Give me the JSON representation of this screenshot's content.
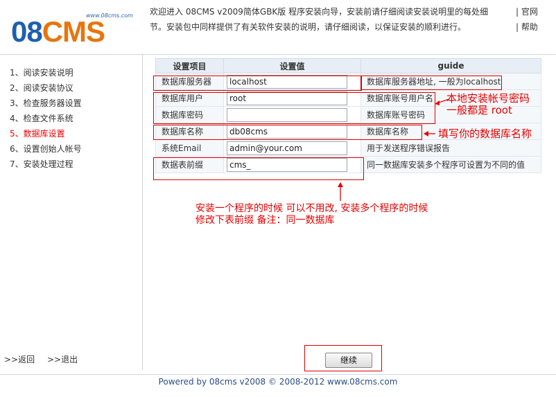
{
  "header": {
    "logo": {
      "tagline": "www.08cms.com",
      "mark_left": "08",
      "mark_right": "CMS"
    },
    "intro_line1": "欢迎进入 08CMS v2009简体GBK版 程序安装向导，安装前请仔细阅读安装说明里的每处细",
    "intro_line2": "节。安装包中同样提供了有关软件安装的说明，请仔细阅读，以保证安装的顺利进行。",
    "links": [
      "| 官网",
      "| 帮助"
    ]
  },
  "sidebar": {
    "steps": [
      {
        "label": "1、阅读安装说明",
        "active": false
      },
      {
        "label": "2、阅读安装协议",
        "active": false
      },
      {
        "label": "3、检查服务器设置",
        "active": false
      },
      {
        "label": "4、检查文件系统",
        "active": false
      },
      {
        "label": "5、数据库设置",
        "active": true
      },
      {
        "label": "6、设置创始人帐号",
        "active": false
      },
      {
        "label": "7、安装处理过程",
        "active": false
      }
    ],
    "back": ">>返回",
    "exit": ">>退出"
  },
  "table": {
    "headers": [
      "设置项目",
      "设置值",
      "guide"
    ],
    "rows": [
      {
        "name": "数据库服务器",
        "value": "localhost",
        "guide": "数据库服务器地址, 一般为localhost"
      },
      {
        "name": "数据库用户",
        "value": "root",
        "guide": "数据库账号用户名"
      },
      {
        "name": "数据库密码",
        "value": "",
        "guide": "数据库账号密码"
      },
      {
        "name": "数据库名称",
        "value": "db08cms",
        "guide": "数据库名称"
      },
      {
        "name": "系统Email",
        "value": "admin@your.com",
        "guide": "用于发送程序错误报告"
      },
      {
        "name": "数据表前缀",
        "value": "cms_",
        "guide": "同一数据库安装多个程序可设置为不同的值"
      }
    ]
  },
  "annotations": {
    "account_line1": "本地安装帐号密码",
    "account_line2": "一般都是 root",
    "dbname": "填写你的数据库名称",
    "prefix_line1": "安装一个程序的时候 可以不用改, 安装多个程序的时候",
    "prefix_line2": "修改下表前缀 备注：同一数据库"
  },
  "button": {
    "continue": "继续"
  },
  "footer": "Powered by 08cms v2008 © 2008-2012  www.08cms.com",
  "colors": {
    "accent_blue": "#1d5fb1",
    "accent_orange": "#e8750d",
    "annotation_red": "#e40000",
    "active_step": "#ee0000"
  }
}
